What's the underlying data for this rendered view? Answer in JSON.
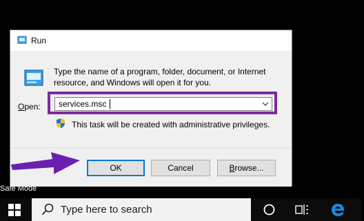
{
  "desktop": {
    "safe_mode_label": "Safe Mode"
  },
  "dialog": {
    "title": "Run",
    "description": "Type the name of a program, folder, document, or Internet resource, and Windows will open it for you.",
    "open_label_underlined": "O",
    "open_label_rest": "pen:",
    "open_value": "services.msc",
    "admin_note": "This task will be created with administrative privileges.",
    "buttons": {
      "ok": "OK",
      "cancel": "Cancel",
      "browse_underlined": "B",
      "browse_rest": "rowse..."
    }
  },
  "taskbar": {
    "search_placeholder": "Type here to search",
    "icons": [
      "windows-start-icon",
      "search-icon",
      "cortana-icon",
      "task-view-icon",
      "edge-icon"
    ]
  },
  "colors": {
    "highlight": "#7c2a9c",
    "arrow": "#6b1fb0",
    "ok_border": "#0078d7",
    "edge_blue": "#1a88e0"
  }
}
